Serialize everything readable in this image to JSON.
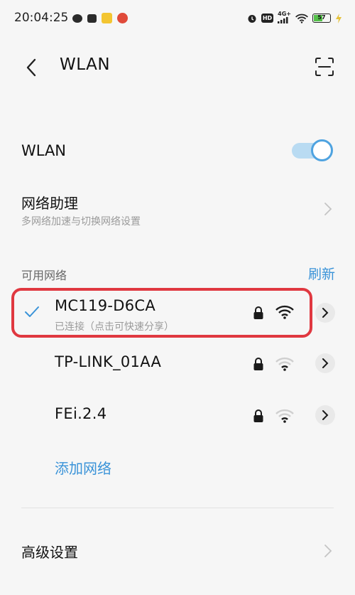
{
  "status_bar": {
    "time": "20:04:25",
    "network_type": "4G+",
    "battery_level": "57"
  },
  "header": {
    "title": "WLAN"
  },
  "wlan_toggle": {
    "label": "WLAN",
    "enabled": true
  },
  "network_assistant": {
    "title": "网络助理",
    "subtitle": "多网络加速与切换网络设置"
  },
  "available_networks": {
    "section_label": "可用网络",
    "refresh_label": "刷新",
    "items": [
      {
        "name": "MC119-D6CA",
        "status": "已连接（点击可快速分享）",
        "connected": true,
        "secured": true
      },
      {
        "name": "TP-LINK_01AA",
        "status": "",
        "connected": false,
        "secured": true
      },
      {
        "name": "FEi.2.4",
        "status": "",
        "connected": false,
        "secured": true
      }
    ],
    "add_network_label": "添加网络"
  },
  "advanced_settings": {
    "label": "高级设置"
  },
  "colors": {
    "accent": "#3a93d8",
    "highlight_border": "#e03840",
    "toggle_track": "#b9dbf2"
  }
}
